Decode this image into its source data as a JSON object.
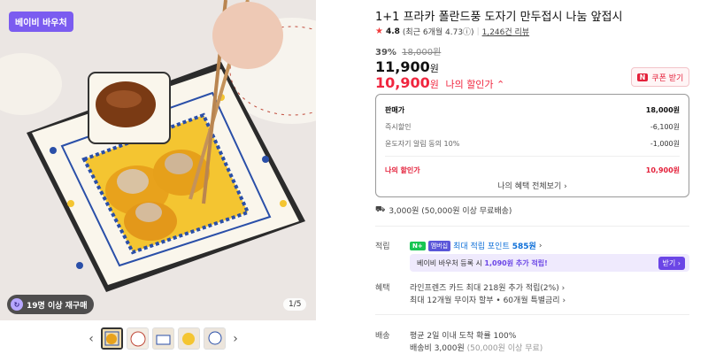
{
  "gallery": {
    "badge": "베이비 바우처",
    "chip": "19명 이상 재구매",
    "counter": "1/5",
    "prev": "‹",
    "next": "›"
  },
  "product": {
    "title": "1+1 프라카 폴란드풍 도자기 만두접시 나눔 앞접시",
    "rating": "4.8",
    "rating_recent": "(최근 6개월 4.73ⓘ)",
    "review_count": "1,246건 리뷰",
    "discount_rate": "39%",
    "original_price": "18,000원",
    "price": "11,900",
    "price_unit": "원",
    "my_price": "10,900",
    "my_price_unit": "원",
    "my_price_label": "나의 할인가 ⌃",
    "coupon_button": "쿠폰 받기",
    "coupon_badge": "N"
  },
  "pricebox": {
    "rows": [
      {
        "label": "판매가",
        "value": "18,000원"
      },
      {
        "label": "즉시할인",
        "value": "-6,100원"
      },
      {
        "label": "윤도자기 알림 동의 10%",
        "value": "-1,000원"
      },
      {
        "label": "나의 할인가",
        "value": "10,900원"
      }
    ],
    "link": "나의 혜택 전체보기 ›"
  },
  "shipping_top": "3,000원 (50,000원 이상 무료배송)",
  "points": {
    "label": "적립",
    "npay": "N+",
    "membership": "멤버십",
    "text": "최대 적립 포인트",
    "amount": "585원",
    "arrow": "›"
  },
  "banner": {
    "text_before": "베이비 바우처 등록 시",
    "highlight": "1,090원 추가 적립!",
    "button": "받기 ›"
  },
  "benefit": {
    "label": "혜택",
    "line1": "라인프렌즈 카드 최대 218원 추가 적립(2%) ›",
    "line2": "최대 12개월 무이자 할부 • 60개월 특별금리 ›"
  },
  "delivery": {
    "label": "배송",
    "line1": "평균 2일 이내 도착 확률 100%",
    "line2": "배송비 3,000원",
    "line2_muted": "(50,000원 이상 무료)"
  }
}
